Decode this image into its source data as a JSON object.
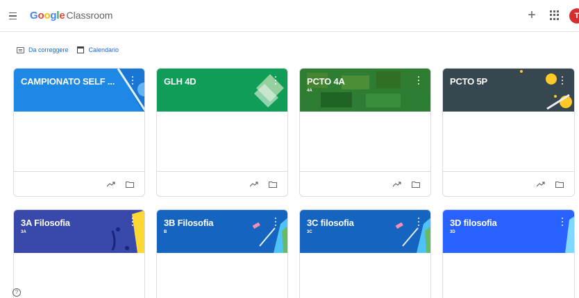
{
  "header": {
    "logo_google": "Google",
    "logo_product": "Classroom",
    "plus_icon": "plus-icon",
    "apps_icon": "apps-grid-icon",
    "avatar_initial": "T"
  },
  "toolbar": {
    "todo_label": "Da correggere",
    "calendar_label": "Calendario"
  },
  "classes": [
    {
      "title": "CAMPIONATO SELF ...",
      "section": "",
      "color": "#1e88e5"
    },
    {
      "title": "GLH 4D",
      "section": "",
      "color": "#0f9d58"
    },
    {
      "title": "PCTO 4A",
      "section": "4A",
      "color": "#1e5e2a"
    },
    {
      "title": "PCTO 5P",
      "section": "",
      "color": "#37474f"
    },
    {
      "title": "3A Filosofia",
      "section": "3A",
      "color": "#3949ab"
    },
    {
      "title": "3B Filosofia",
      "section": "B",
      "color": "#1565c0"
    },
    {
      "title": "3C filosofia",
      "section": "3C",
      "color": "#1565c0"
    },
    {
      "title": "3D filosofia",
      "section": "3D",
      "color": "#2962ff"
    }
  ],
  "help_label": "?"
}
